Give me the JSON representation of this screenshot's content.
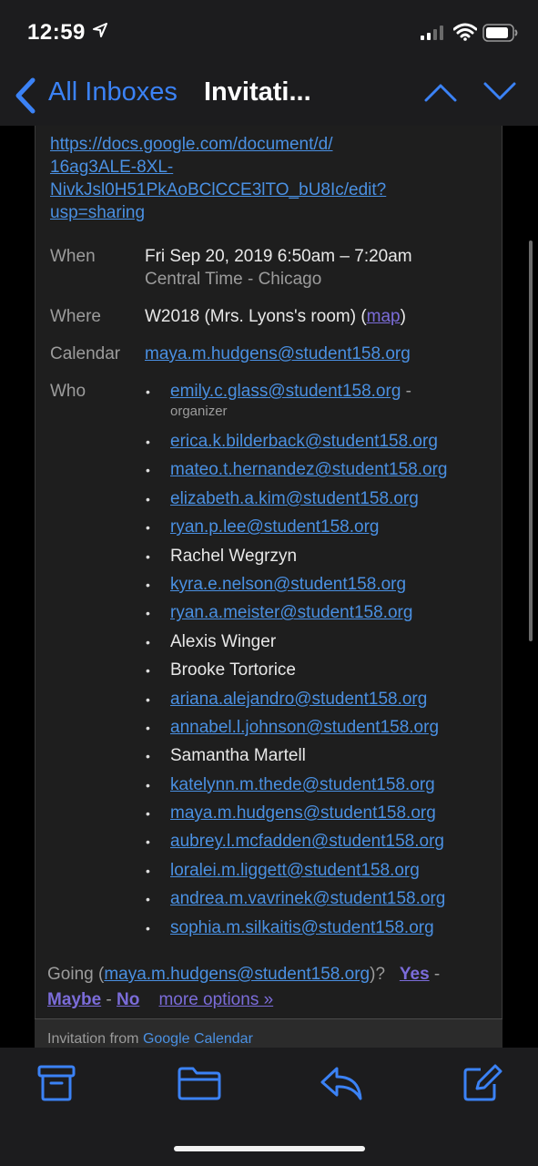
{
  "status": {
    "time": "12:59"
  },
  "nav": {
    "back_label": "All Inboxes",
    "title": "Invitati..."
  },
  "doc_link": [
    "https://docs.google.com/document/d/",
    "16ag3ALE-8XL-",
    "NivkJsl0H51PkAoBClCCE3lTO_bU8Ic/edit?",
    "usp=sharing"
  ],
  "details": {
    "when_label": "When",
    "when_value": "Fri Sep 20, 2019 6:50am – 7:20am",
    "when_tz": "Central Time - Chicago",
    "where_label": "Where",
    "where_value": "W2018 (Mrs. Lyons's room) (",
    "where_map": "map",
    "where_close": ")",
    "calendar_label": "Calendar",
    "calendar_value": "maya.m.hudgens@student158.org",
    "who_label": "Who"
  },
  "who": {
    "organizer_email": "emily.c.glass@student158.org",
    "organizer_dash": " -",
    "organizer_tag": "organizer",
    "guests": [
      {
        "text": "erica.k.bilderback@student158.org",
        "email": true
      },
      {
        "text": "mateo.t.hernandez@student158.org",
        "email": true
      },
      {
        "text": "elizabeth.a.kim@student158.org",
        "email": true
      },
      {
        "text": "ryan.p.lee@student158.org",
        "email": true
      },
      {
        "text": "Rachel Wegrzyn",
        "email": false
      },
      {
        "text": "kyra.e.nelson@student158.org",
        "email": true
      },
      {
        "text": "ryan.a.meister@student158.org",
        "email": true
      },
      {
        "text": "Alexis Winger",
        "email": false
      },
      {
        "text": "Brooke Tortorice",
        "email": false
      },
      {
        "text": "ariana.alejandro@student158.org",
        "email": true
      },
      {
        "text": "annabel.l.johnson@student158.org",
        "email": true
      },
      {
        "text": "Samantha Martell",
        "email": false
      },
      {
        "text": "katelynn.m.thede@student158.org",
        "email": true
      },
      {
        "text": "maya.m.hudgens@student158.org",
        "email": true
      },
      {
        "text": "aubrey.l.mcfadden@student158.org",
        "email": true
      },
      {
        "text": "loralei.m.liggett@student158.org",
        "email": true
      },
      {
        "text": "andrea.m.vavrinek@student158.org",
        "email": true
      },
      {
        "text": "sophia.m.silkaitis@student158.org",
        "email": true
      }
    ]
  },
  "going": {
    "prefix": "Going (",
    "email": "maya.m.hudgens@student158.org",
    "suffix": ")?",
    "yes": "Yes",
    "sep1": " - ",
    "maybe": "Maybe",
    "sep2": " - ",
    "no": "No",
    "more": "more options »"
  },
  "footer": {
    "prefix": "Invitation from ",
    "link": "Google Calendar"
  },
  "colors": {
    "accent": "#3b82f6",
    "link": "#4a90e2",
    "visited": "#7b6cd9",
    "background": "#000000"
  },
  "toolbar": [
    "archive-icon",
    "folder-icon",
    "reply-icon",
    "compose-icon"
  ]
}
